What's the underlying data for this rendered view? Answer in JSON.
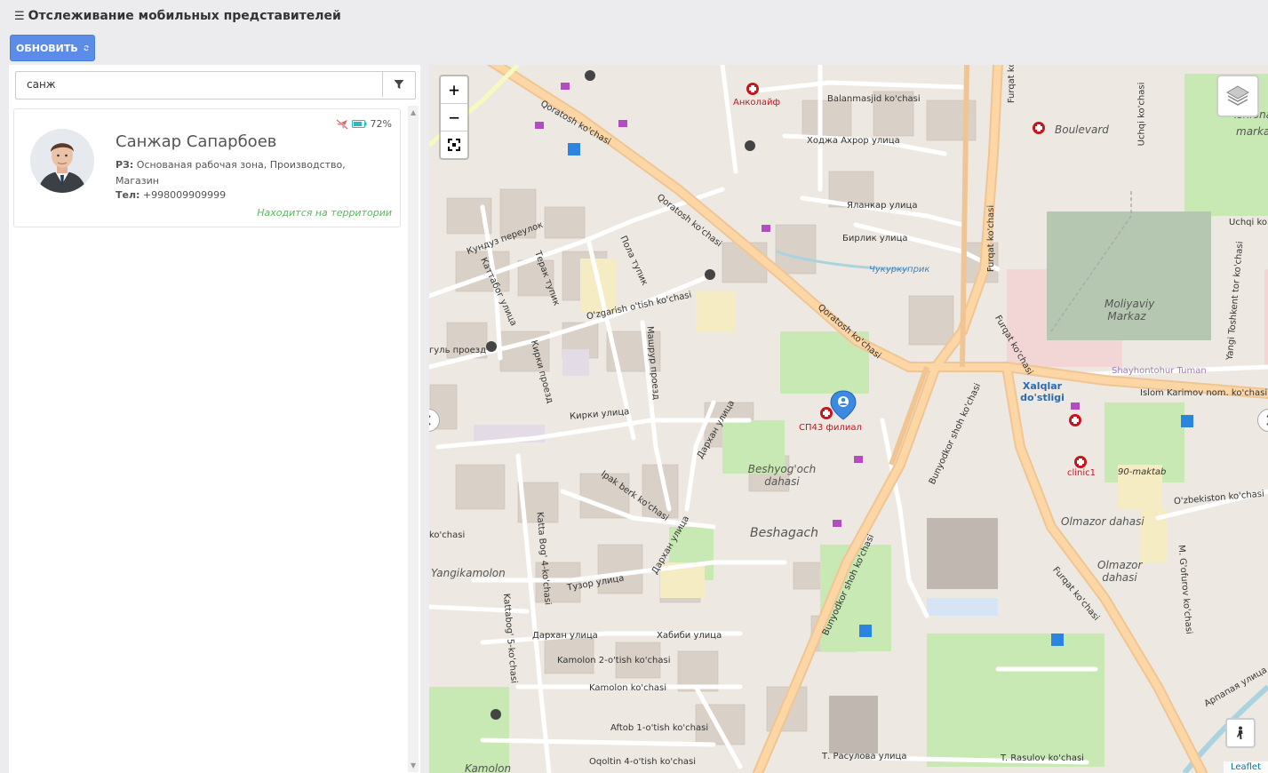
{
  "header": {
    "title": "Отслеживание мобильных представителей"
  },
  "toolbar": {
    "refresh_label": "ОБНОВИТЬ"
  },
  "search": {
    "value": "санж"
  },
  "agents": [
    {
      "name": "Санжар Сапарбоев",
      "zone_label": "РЗ:",
      "zone_value": "Основаная рабочая зона, Производство, Магазин",
      "phone_label": "Тел:",
      "phone_value": "+998009909999",
      "battery": "72%",
      "status": "Находится на территории"
    }
  ],
  "map": {
    "labels": {
      "ankolayf": "Анколайф",
      "balanmasjid": "Balanmasjid ko'chasi",
      "khoja": "Ходжа Ахрор улица",
      "yalankar": "Яланкар улица",
      "birlik": "Бирлик улица",
      "chukurkupruk": "Чукуркуприк",
      "boulevard": "Boulevard",
      "qoratosh1": "Qoratosh ko'chasi",
      "qoratosh2": "Qoratosh ko'chasi",
      "qoratosh3": "Qoratosh ko'chasi",
      "kunduz": "Кундуз переулок",
      "pola": "Пола тупик",
      "terak": "Терак тупик",
      "kattabog": "Каттабог улица",
      "ozgarish": "O'zgarish o'tish ko'chasi",
      "mashrur": "Машрур проезд",
      "gul": "гуль проезд",
      "kirki1": "Кирки проезд",
      "kirki2": "Кирки улица",
      "darkhan1": "Дархан улица",
      "sp43": "СП43 филиал",
      "beshyogoch": "Beshyog'och dahasi",
      "beshagach": "Beshagach",
      "ipak": "Ipak berk ko'chasi",
      "bunyodkor1": "Bunyodkor shoh ko'chasi",
      "bunyodkor2": "Bunyodkor shoh ko'chasi",
      "furqat1": "Furqat ko'chasi",
      "furqat2": "Furqat ko'chasi",
      "furqat3": "Furqat ko'chasi",
      "furqat4": "Furqat ko'chasi",
      "xalqlar": "Xalqlar do'stligi",
      "islom": "Islom Karimov nom. ko'chasi",
      "shayhontohur": "Shayhontohur Tuman",
      "moliyaviy": "Moliyaviy Markaz",
      "clinic1": "clinic1",
      "maktab": "90-maktab",
      "olmazor1": "Olmazor dahasi",
      "olmazor2": "Olmazor dahasi",
      "ozbekiston": "O'zbekiston ko'chasi",
      "yangikamolon": "Yangikamolon",
      "darkhan2": "Дархан улица",
      "darkhan3": "Дархан улица",
      "tuzor": "Тузор улица",
      "khabibi": "Хабиби улица",
      "kamolon2": "Kamolon 2-o'tish ko'chasi",
      "kamolon": "Kamolon ko'chasi",
      "aftob": "Aftob 1-o'tish ko'chasi",
      "oqoltin": "Oqoltin 4-o'tish ko'chasi",
      "rasulova": "Т. Расулова улица",
      "rasulov": "T. Rasulov ko'chasi",
      "uchi1": "Uchqi ko'chasi",
      "uchi2": "Uchqi ko'chasi",
      "yangi": "Yangi Toshkent tor ko'chasi",
      "gofurov": "M. G'ofurov ko'chasi",
      "arpapoya": "Арпапая улица",
      "ishlonarm": "Ishlonarm",
      "marka": "marka",
      "kattabog5": "Kattabog' 5-ko'chasi",
      "kattabog4": "Katta Bog' 4-ko'chasi",
      "kochasi": "ko'chasi",
      "kamolon_b": "Kamolon"
    },
    "attribution": "Leaflet"
  }
}
